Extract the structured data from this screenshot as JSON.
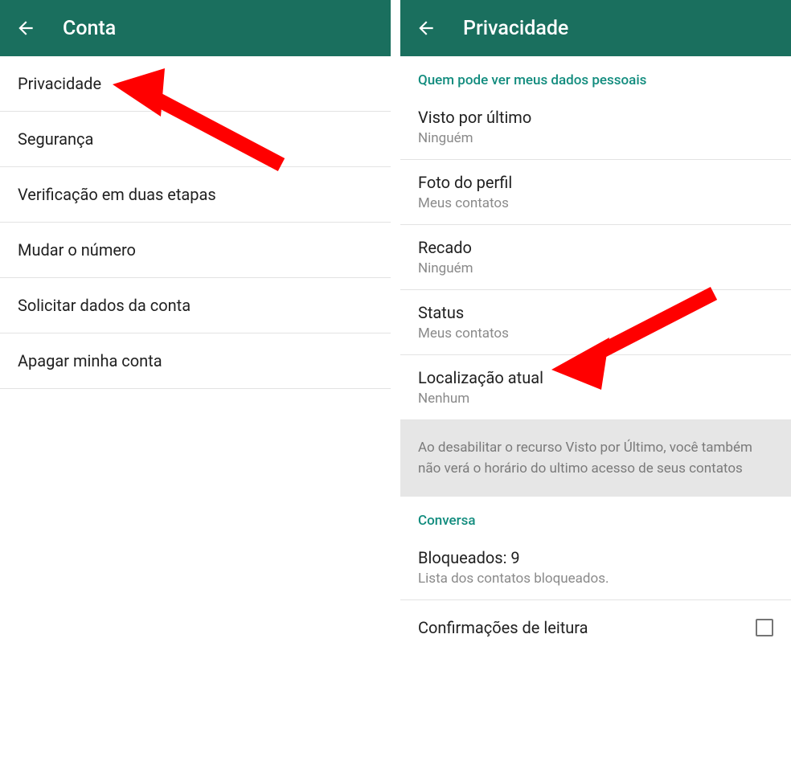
{
  "left": {
    "header": {
      "title": "Conta"
    },
    "items": [
      {
        "label": "Privacidade"
      },
      {
        "label": "Segurança"
      },
      {
        "label": "Verificação em duas etapas"
      },
      {
        "label": "Mudar o número"
      },
      {
        "label": "Solicitar dados da conta"
      },
      {
        "label": "Apagar minha conta"
      }
    ]
  },
  "right": {
    "header": {
      "title": "Privacidade"
    },
    "section1_header": "Quem pode ver meus dados pessoais",
    "items": [
      {
        "label": "Visto por último",
        "value": "Ninguém"
      },
      {
        "label": "Foto do perfil",
        "value": "Meus contatos"
      },
      {
        "label": "Recado",
        "value": "Ninguém"
      },
      {
        "label": "Status",
        "value": "Meus contatos"
      },
      {
        "label": "Localização atual",
        "value": "Nenhum"
      }
    ],
    "info_text": "Ao desabilitar o recurso Visto por Último, você também não verá o horário do ultimo acesso de seus contatos",
    "section2_header": "Conversa",
    "blocked": {
      "label": "Bloqueados: 9",
      "value": "Lista dos contatos bloqueados."
    },
    "read_receipts": {
      "label": "Confirmações de leitura"
    }
  },
  "colors": {
    "header_bg": "#1a6f5e",
    "accent": "#128c7e",
    "arrow": "#ff0000"
  }
}
